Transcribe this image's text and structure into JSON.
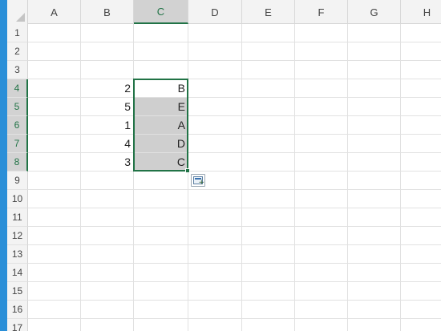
{
  "columns": [
    "A",
    "B",
    "C",
    "D",
    "E",
    "F",
    "G",
    "H"
  ],
  "rows": [
    "1",
    "2",
    "3",
    "4",
    "5",
    "6",
    "7",
    "8",
    "9",
    "10",
    "11",
    "12",
    "13",
    "14",
    "15",
    "16",
    "17"
  ],
  "selected_column": "C",
  "selected_rows": [
    "4",
    "5",
    "6",
    "7",
    "8"
  ],
  "cells": {
    "B4": "2",
    "B5": "5",
    "B6": "1",
    "B7": "4",
    "B8": "3",
    "C4": "B",
    "C5": "E",
    "C6": "A",
    "C7": "D",
    "C8": "C"
  },
  "colors": {
    "accent": "#217346",
    "strip": "#2a8fd8",
    "selection_fill": "#cfcfcf"
  },
  "icons": {
    "corner": "select-all-triangle",
    "quick_analysis": "quick-analysis-icon"
  }
}
